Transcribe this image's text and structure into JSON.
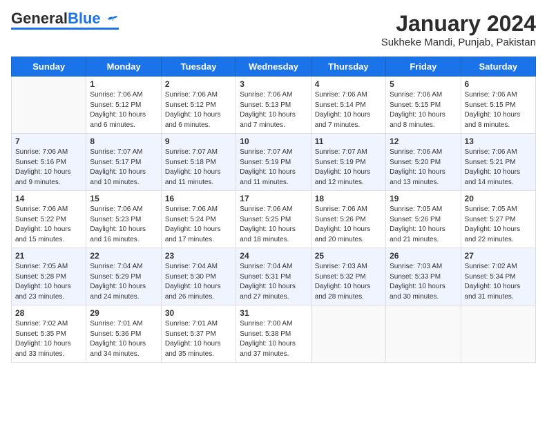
{
  "header": {
    "logo_general": "General",
    "logo_blue": "Blue",
    "title": "January 2024",
    "subtitle": "Sukheke Mandi, Punjab, Pakistan"
  },
  "weekdays": [
    "Sunday",
    "Monday",
    "Tuesday",
    "Wednesday",
    "Thursday",
    "Friday",
    "Saturday"
  ],
  "weeks": [
    [
      {
        "day": "",
        "info": ""
      },
      {
        "day": "1",
        "info": "Sunrise: 7:06 AM\nSunset: 5:12 PM\nDaylight: 10 hours\nand 6 minutes."
      },
      {
        "day": "2",
        "info": "Sunrise: 7:06 AM\nSunset: 5:12 PM\nDaylight: 10 hours\nand 6 minutes."
      },
      {
        "day": "3",
        "info": "Sunrise: 7:06 AM\nSunset: 5:13 PM\nDaylight: 10 hours\nand 7 minutes."
      },
      {
        "day": "4",
        "info": "Sunrise: 7:06 AM\nSunset: 5:14 PM\nDaylight: 10 hours\nand 7 minutes."
      },
      {
        "day": "5",
        "info": "Sunrise: 7:06 AM\nSunset: 5:15 PM\nDaylight: 10 hours\nand 8 minutes."
      },
      {
        "day": "6",
        "info": "Sunrise: 7:06 AM\nSunset: 5:15 PM\nDaylight: 10 hours\nand 8 minutes."
      }
    ],
    [
      {
        "day": "7",
        "info": "Sunrise: 7:06 AM\nSunset: 5:16 PM\nDaylight: 10 hours\nand 9 minutes."
      },
      {
        "day": "8",
        "info": "Sunrise: 7:07 AM\nSunset: 5:17 PM\nDaylight: 10 hours\nand 10 minutes."
      },
      {
        "day": "9",
        "info": "Sunrise: 7:07 AM\nSunset: 5:18 PM\nDaylight: 10 hours\nand 11 minutes."
      },
      {
        "day": "10",
        "info": "Sunrise: 7:07 AM\nSunset: 5:19 PM\nDaylight: 10 hours\nand 11 minutes."
      },
      {
        "day": "11",
        "info": "Sunrise: 7:07 AM\nSunset: 5:19 PM\nDaylight: 10 hours\nand 12 minutes."
      },
      {
        "day": "12",
        "info": "Sunrise: 7:06 AM\nSunset: 5:20 PM\nDaylight: 10 hours\nand 13 minutes."
      },
      {
        "day": "13",
        "info": "Sunrise: 7:06 AM\nSunset: 5:21 PM\nDaylight: 10 hours\nand 14 minutes."
      }
    ],
    [
      {
        "day": "14",
        "info": "Sunrise: 7:06 AM\nSunset: 5:22 PM\nDaylight: 10 hours\nand 15 minutes."
      },
      {
        "day": "15",
        "info": "Sunrise: 7:06 AM\nSunset: 5:23 PM\nDaylight: 10 hours\nand 16 minutes."
      },
      {
        "day": "16",
        "info": "Sunrise: 7:06 AM\nSunset: 5:24 PM\nDaylight: 10 hours\nand 17 minutes."
      },
      {
        "day": "17",
        "info": "Sunrise: 7:06 AM\nSunset: 5:25 PM\nDaylight: 10 hours\nand 18 minutes."
      },
      {
        "day": "18",
        "info": "Sunrise: 7:06 AM\nSunset: 5:26 PM\nDaylight: 10 hours\nand 20 minutes."
      },
      {
        "day": "19",
        "info": "Sunrise: 7:05 AM\nSunset: 5:26 PM\nDaylight: 10 hours\nand 21 minutes."
      },
      {
        "day": "20",
        "info": "Sunrise: 7:05 AM\nSunset: 5:27 PM\nDaylight: 10 hours\nand 22 minutes."
      }
    ],
    [
      {
        "day": "21",
        "info": "Sunrise: 7:05 AM\nSunset: 5:28 PM\nDaylight: 10 hours\nand 23 minutes."
      },
      {
        "day": "22",
        "info": "Sunrise: 7:04 AM\nSunset: 5:29 PM\nDaylight: 10 hours\nand 24 minutes."
      },
      {
        "day": "23",
        "info": "Sunrise: 7:04 AM\nSunset: 5:30 PM\nDaylight: 10 hours\nand 26 minutes."
      },
      {
        "day": "24",
        "info": "Sunrise: 7:04 AM\nSunset: 5:31 PM\nDaylight: 10 hours\nand 27 minutes."
      },
      {
        "day": "25",
        "info": "Sunrise: 7:03 AM\nSunset: 5:32 PM\nDaylight: 10 hours\nand 28 minutes."
      },
      {
        "day": "26",
        "info": "Sunrise: 7:03 AM\nSunset: 5:33 PM\nDaylight: 10 hours\nand 30 minutes."
      },
      {
        "day": "27",
        "info": "Sunrise: 7:02 AM\nSunset: 5:34 PM\nDaylight: 10 hours\nand 31 minutes."
      }
    ],
    [
      {
        "day": "28",
        "info": "Sunrise: 7:02 AM\nSunset: 5:35 PM\nDaylight: 10 hours\nand 33 minutes."
      },
      {
        "day": "29",
        "info": "Sunrise: 7:01 AM\nSunset: 5:36 PM\nDaylight: 10 hours\nand 34 minutes."
      },
      {
        "day": "30",
        "info": "Sunrise: 7:01 AM\nSunset: 5:37 PM\nDaylight: 10 hours\nand 35 minutes."
      },
      {
        "day": "31",
        "info": "Sunrise: 7:00 AM\nSunset: 5:38 PM\nDaylight: 10 hours\nand 37 minutes."
      },
      {
        "day": "",
        "info": ""
      },
      {
        "day": "",
        "info": ""
      },
      {
        "day": "",
        "info": ""
      }
    ]
  ]
}
